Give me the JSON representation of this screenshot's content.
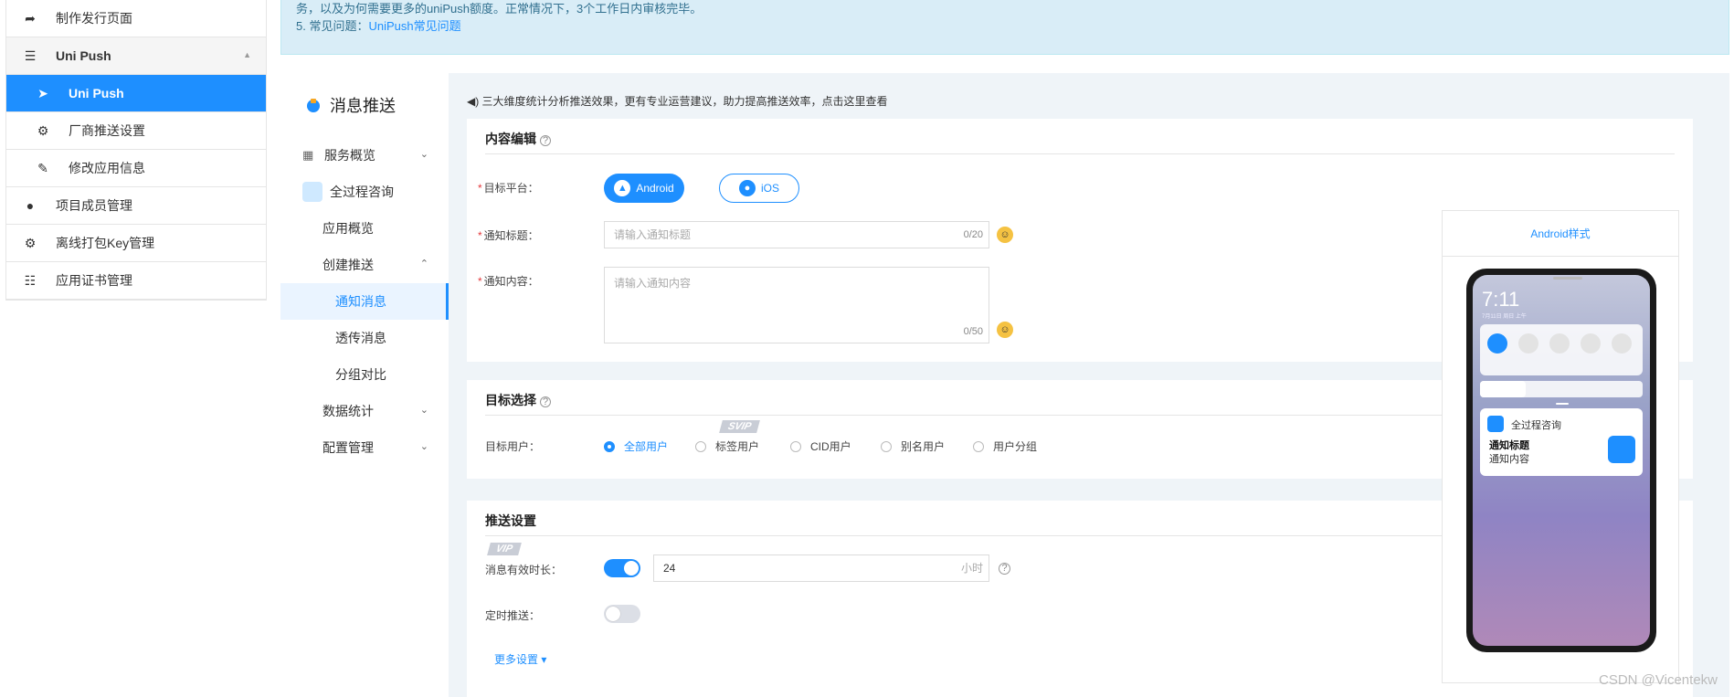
{
  "sidebar": {
    "items": [
      {
        "label": "制作发行页面"
      },
      {
        "label": "Uni Push"
      },
      {
        "label": "Uni Push"
      },
      {
        "label": "厂商推送设置"
      },
      {
        "label": "修改应用信息"
      },
      {
        "label": "项目成员管理"
      },
      {
        "label": "离线打包Key管理"
      },
      {
        "label": "应用证书管理"
      }
    ]
  },
  "banner": {
    "line1": "务，以及为何需要更多的uniPush额度。正常情况下，3个工作日内审核完毕。",
    "line2_prefix": "5. 常见问题：",
    "line2_link": "UniPush常见问题"
  },
  "nav2": {
    "title": "消息推送",
    "items": [
      {
        "label": "服务概览"
      },
      {
        "label": "全过程咨询"
      },
      {
        "label": "应用概览"
      },
      {
        "label": "创建推送"
      },
      {
        "label": "通知消息"
      },
      {
        "label": "透传消息"
      },
      {
        "label": "分组对比"
      },
      {
        "label": "数据统计"
      },
      {
        "label": "配置管理"
      }
    ]
  },
  "tip": "◀) 三大维度统计分析推送效果，更有专业运营建议，助力提高推送效率，点击这里查看",
  "content_edit": {
    "title": "内容编辑",
    "platform_label": "目标平台：",
    "android": "Android",
    "ios": "iOS",
    "title_label": "通知标题：",
    "title_placeholder": "请输入通知标题",
    "title_count": "0/20",
    "content_label": "通知内容：",
    "content_placeholder": "请输入通知内容",
    "content_count": "0/50"
  },
  "target": {
    "title": "目标选择",
    "user_label": "目标用户：",
    "options": [
      "全部用户",
      "标签用户",
      "CID用户",
      "别名用户",
      "用户分组"
    ],
    "svip": "SVIP"
  },
  "push_settings": {
    "title": "推送设置",
    "vip": "VIP",
    "ttl_label": "消息有效时长：",
    "ttl_value": "24",
    "ttl_unit": "小时",
    "schedule_label": "定时推送：",
    "more": "更多设置 ▾"
  },
  "preview": {
    "title": "Android样式",
    "time": "7:11",
    "subtime": "7月11日 周日 上午",
    "app_name": "全过程咨询",
    "notif_title": "通知标题",
    "notif_content": "通知内容"
  },
  "watermark": "CSDN @Vicentekw"
}
